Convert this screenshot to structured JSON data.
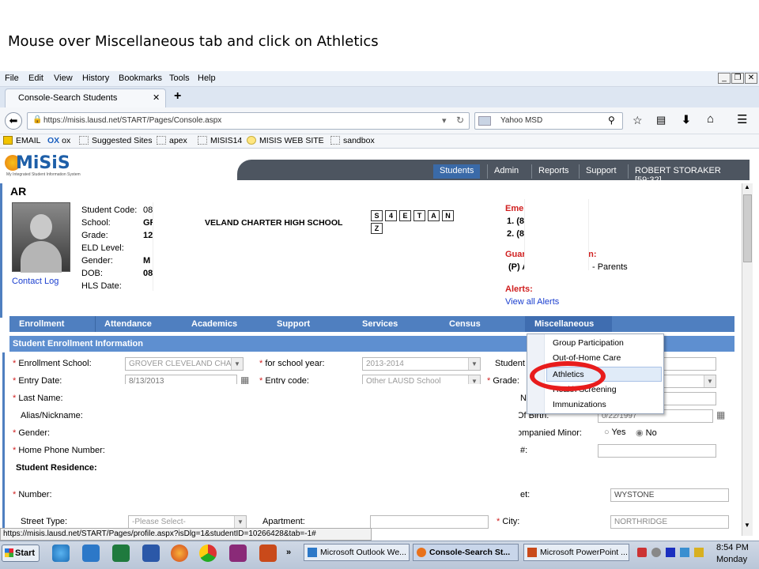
{
  "caption": "Mouse over Miscellaneous tab and click on Athletics",
  "browser": {
    "menu": [
      "File",
      "Edit",
      "View",
      "History",
      "Bookmarks",
      "Tools",
      "Help"
    ],
    "tab_title": "Console-Search Students",
    "url": "https://misis.lausd.net/START/Pages/Console.aspx",
    "search_engine": "Yahoo MSD",
    "bookmarks": [
      "EMAIL",
      "ox",
      "Suggested Sites",
      "apex",
      "MISIS14",
      "MISIS WEB SITE",
      "sandbox"
    ],
    "status_url": "https://misis.lausd.net/START/Pages/profile.aspx?isDlg=1&studentID=10266428&tab=-1#"
  },
  "app": {
    "logo": "MiSiS",
    "logo_sub": "My Integrated Student Information System",
    "top_nav": [
      "Students",
      "Admin",
      "Reports",
      "Support",
      "ROBERT STORAKER [59:32]"
    ]
  },
  "student": {
    "name_partial": "AR",
    "fields": [
      {
        "label": "Student Code:",
        "value": "08"
      },
      {
        "label": "School:",
        "value": "GR"
      },
      {
        "label": "Grade:",
        "value": "12"
      },
      {
        "label": "ELD Level:",
        "value": ""
      },
      {
        "label": "Gender:",
        "value": "M"
      },
      {
        "label": "DOB:",
        "value": "08"
      },
      {
        "label": "HLS Date:",
        "value": ""
      }
    ],
    "school_suffix": "VELAND CHARTER HIGH SCHOOL",
    "contact_log": "Contact Log",
    "flags": [
      "S",
      "4",
      "E",
      "T",
      "A",
      "N",
      "Z"
    ],
    "emergency_title": "Emergency Contact:",
    "emergency": [
      "1. (8",
      "2. (8"
    ],
    "guardian_title": "Guardian Information:",
    "guardian_prefix": "(P) A",
    "guardian_suffix": "- Parents",
    "alerts_title": "Alerts:",
    "view_alerts": "View all Alerts"
  },
  "tabs": [
    "Enrollment",
    "Attendance",
    "Academics",
    "Support",
    "Services",
    "Census",
    "Miscellaneous"
  ],
  "section_title": "Student Enrollment Information",
  "form": {
    "enrollment_school_label": "Enrollment School:",
    "enrollment_school_value": "GROVER CLEVELAND CHA",
    "school_year_label": "for school year:",
    "school_year_value": "2013-2014",
    "student_label": "Student",
    "entry_date_label": "Entry Date:",
    "entry_date_value": "8/13/2013",
    "entry_code_label": "Entry code:",
    "entry_code_value": "Other LAUSD School",
    "grade_label": "Grade:",
    "last_name_label": "Last Name:",
    "alias_label": "Alias/Nickname:",
    "gender_label": "Gender:",
    "home_phone_label": "Home Phone Number:",
    "residence_label": "Student Residence:",
    "number_label": "Number:",
    "street_type_label": "Street Type:",
    "street_type_placeholder": "-Please Select-",
    "apartment_label": "Apartment:",
    "city_label": "City:",
    "city_value": "NORTHRIDGE",
    "street_value": "WYSTONE",
    "dob_value": "0/22/1997",
    "frag_n": "N",
    "frag_birth": "Of Birth:",
    "frag_minor": "ompanied Minor:",
    "frag_hash": "#:",
    "frag_et": "et:",
    "yes_label": "Yes",
    "no_label": "No"
  },
  "dropdown": [
    "Group Participation",
    "Out-of-Home Care",
    "Athletics",
    "Health Screening",
    "Immunizations"
  ],
  "taskbar": {
    "start": "Start",
    "buttons": [
      "Microsoft Outlook We...",
      "Console-Search St...",
      "Microsoft PowerPoint ..."
    ],
    "time": "8:54 PM",
    "day": "Monday"
  },
  "colors": {
    "tab_blue": "#4f7fc0",
    "ring_red": "#e81c1c",
    "app_dark": "#4d5560"
  }
}
